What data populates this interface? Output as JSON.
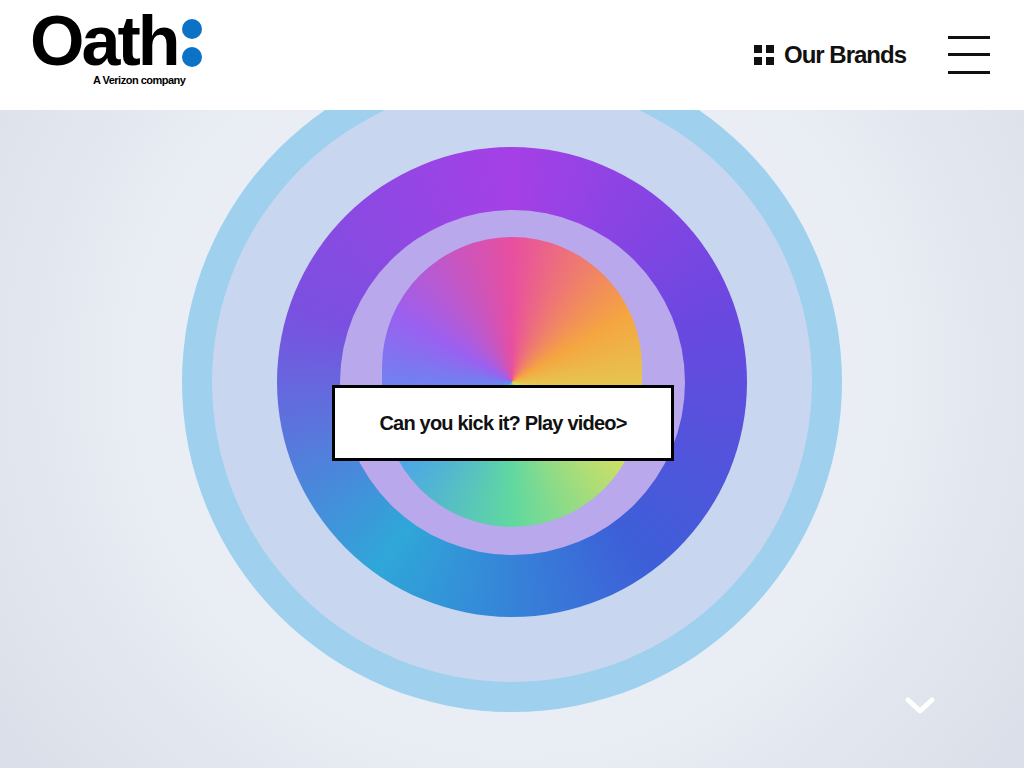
{
  "logo": {
    "text": "Oath",
    "tagline": "A Verizon company"
  },
  "nav": {
    "brands": "Our Brands"
  },
  "hero": {
    "cta": "Can you kick it? Play video>"
  }
}
